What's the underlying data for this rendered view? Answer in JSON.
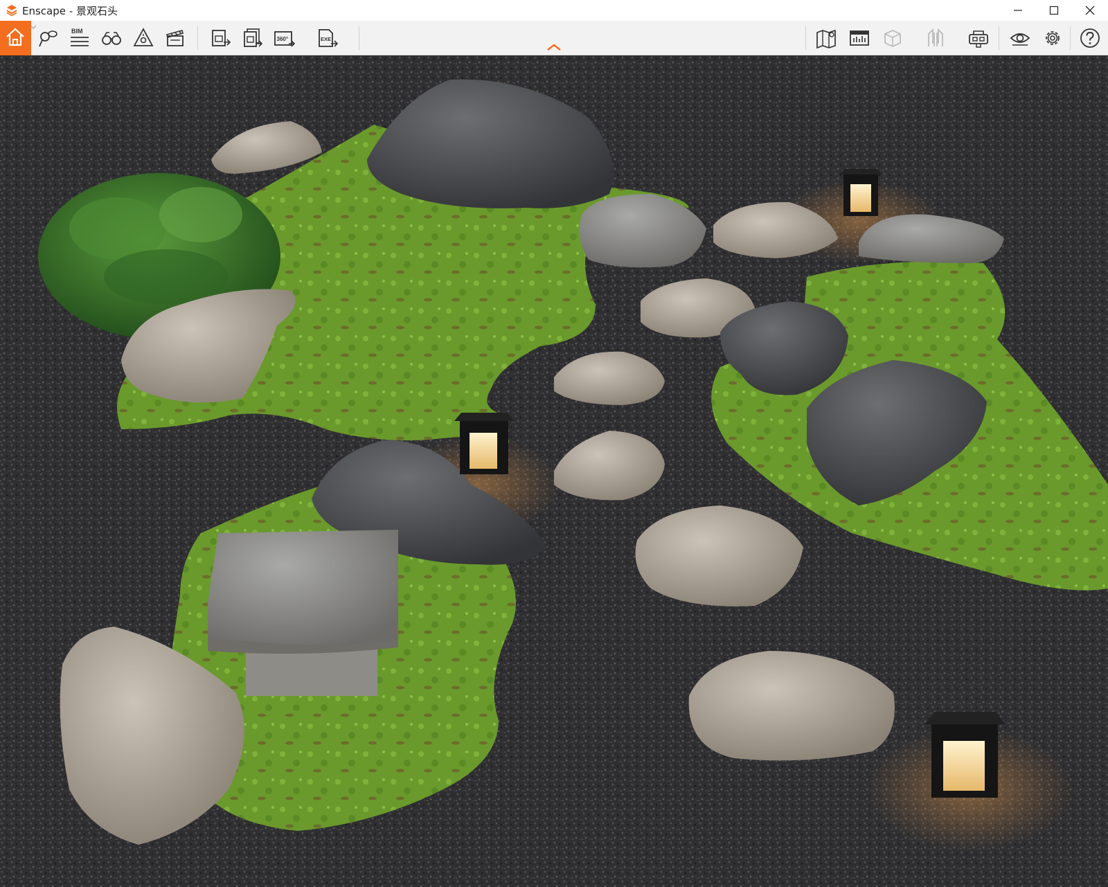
{
  "window": {
    "app_name": "Enscape",
    "separator": " - ",
    "project_name": "景观石头",
    "minimize_icon": "minimize-icon",
    "maximize_icon": "maximize-icon",
    "close_icon": "close-icon"
  },
  "toolbar": {
    "bim_label": "BIM",
    "panorama_label": "360°",
    "exe_label": "EXE",
    "accent_color": "#f36e1f",
    "left_tools": [
      "home-icon",
      "views-pin-icon",
      "bim-icon",
      "binoculars-icon",
      "light-view-icon",
      "video-editor-icon",
      "screenshot-export-icon",
      "batch-render-icon",
      "panorama-export-icon",
      "exe-export-icon"
    ],
    "right_tools": [
      "map-icon",
      "asset-library-icon",
      "box-icon",
      "section-icon",
      "vr-headset-icon",
      "visibility-icon",
      "settings-icon",
      "help-icon"
    ]
  },
  "scene": {
    "description_type": "3d-render-viewport",
    "colors": {
      "gravel": "#2f2f31",
      "moss": "#6a9a2c",
      "stone": "#a9a095",
      "dark_rock": "#4a4b4e"
    }
  }
}
